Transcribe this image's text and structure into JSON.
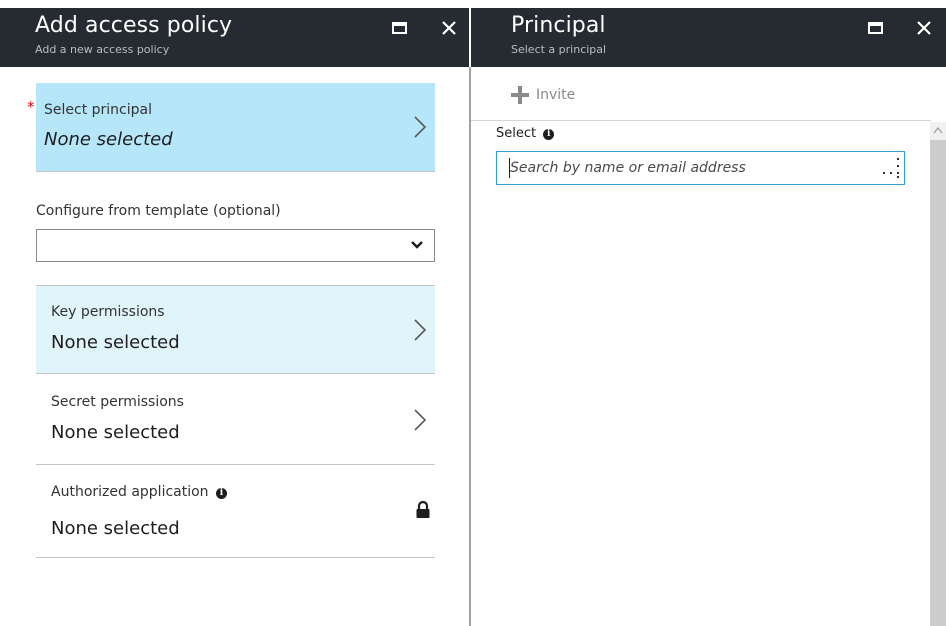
{
  "left_blade": {
    "title": "Add access policy",
    "subtitle": "Add a new access policy",
    "principal": {
      "required_mark": "*",
      "label": "Select principal",
      "value": "None selected"
    },
    "template": {
      "label": "Configure from template (optional)",
      "selected": ""
    },
    "key_permissions": {
      "label": "Key permissions",
      "value": "None selected"
    },
    "secret_permissions": {
      "label": "Secret permissions",
      "value": "None selected"
    },
    "authorized_application": {
      "label": "Authorized application",
      "value": "None selected"
    }
  },
  "right_blade": {
    "title": "Principal",
    "subtitle": "Select a principal",
    "invite_label": "Invite",
    "select_label": "Select",
    "search_placeholder": "Search by name or email address",
    "search_value": ""
  },
  "colors": {
    "header_bg": "#252b30",
    "selected_row": "#b5e6fa",
    "hover_row": "#e0f4fc",
    "focus_border": "#3aa0d4",
    "required": "#e00b1c"
  },
  "icons": [
    "maximize-icon",
    "close-icon",
    "chevron-right-icon",
    "chevron-down-icon",
    "info-icon",
    "lock-icon",
    "plus-icon",
    "resize-handle-icon",
    "scroll-up-icon"
  ]
}
